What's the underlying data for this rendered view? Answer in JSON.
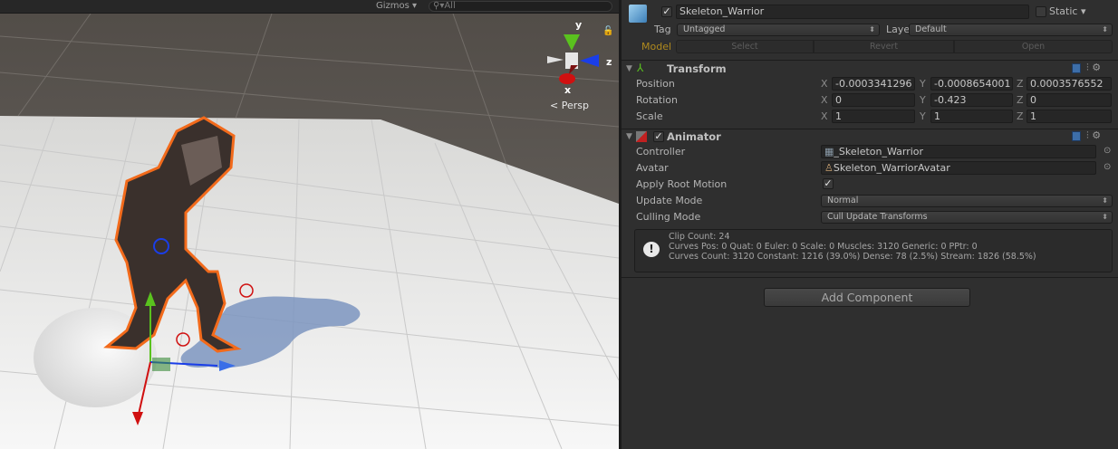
{
  "scene": {
    "gizmos_label": "Gizmos",
    "search_placeholder": "All",
    "axes": {
      "x": "x",
      "y": "y",
      "z": "z"
    },
    "projection": "Persp"
  },
  "inspector": {
    "object": {
      "active": true,
      "name": "Skeleton_Warrior",
      "static_label": "Static",
      "static": false
    },
    "tag_label": "Tag",
    "tag_value": "Untagged",
    "layer_label": "Layer",
    "layer_value": "Default",
    "model_label": "Model",
    "model_buttons": [
      "Select",
      "Revert",
      "Open"
    ],
    "transform": {
      "title": "Transform",
      "rows": [
        {
          "label": "Position",
          "x": "-0.0003341296",
          "y": "-0.0008654001",
          "z": "0.0003576552"
        },
        {
          "label": "Rotation",
          "x": "0",
          "y": "-0.423",
          "z": "0"
        },
        {
          "label": "Scale",
          "x": "1",
          "y": "1",
          "z": "1"
        }
      ]
    },
    "animator": {
      "title": "Animator",
      "enabled": true,
      "controller_label": "Controller",
      "controller_value": "_Skeleton_Warrior",
      "avatar_label": "Avatar",
      "avatar_value": "Skeleton_WarriorAvatar",
      "root_motion_label": "Apply Root Motion",
      "root_motion": true,
      "update_mode_label": "Update Mode",
      "update_mode_value": "Normal",
      "culling_mode_label": "Culling Mode",
      "culling_mode_value": "Cull Update Transforms",
      "info": [
        "Clip Count: 24",
        "Curves Pos: 0 Quat: 0 Euler: 0 Scale: 0 Muscles: 3120 Generic: 0 PPtr: 0",
        "Curves Count: 3120 Constant: 1216 (39.0%) Dense: 78 (2.5%) Stream: 1826 (58.5%)"
      ]
    },
    "add_component_label": "Add Component"
  },
  "colors": {
    "model_label": "#b08a1e",
    "selection_outline": "#f26a1b",
    "axis_x": "#d01010",
    "axis_y": "#5ac21e",
    "axis_z": "#1a3ee8"
  }
}
